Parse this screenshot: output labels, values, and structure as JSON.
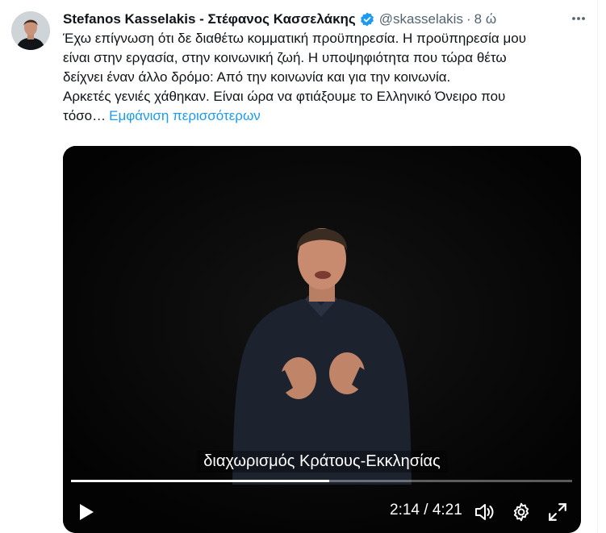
{
  "tweet": {
    "author_name": "Stefanos Kasselakis - Στέφανος Κασσελάκης",
    "handle": "@skasselakis",
    "separator": "·",
    "time": "8 ώ",
    "text_lines": [
      "Έχω επίγνωση ότι δε διαθέτω κομματική προϋπηρεσία. Η προϋπηρεσία μου",
      "είναι στην εργασία, στην κοινωνική ζωή. Η υποψηφιότητα που τώρα θέτω",
      "δείχνει έναν άλλο δρόμο: Από την κοινωνία και για την κοινωνία.",
      "Αρκετές γενιές χάθηκαν. Είναι ώρα να φτιάξουμε το Ελληνικό Όνειρο που",
      "τόσο…"
    ],
    "show_more": "Εμφάνιση περισσότερων",
    "icons": {
      "verified": "verified-badge-icon",
      "more": "more-options-icon"
    }
  },
  "video": {
    "caption": "διαχωρισμός Κράτους-Εκκλησίας",
    "current_time": "2:14",
    "duration": "4:21",
    "time_display": "2:14 / 4:21",
    "progress_fraction": 0.515,
    "icons": {
      "play": "play-icon",
      "volume": "volume-icon",
      "settings": "gear-icon",
      "fullscreen": "fullscreen-icon"
    }
  },
  "colors": {
    "link": "#1d9bf0",
    "text": "#0f1419",
    "secondary": "#536471",
    "verified": "#1d9bf0"
  }
}
